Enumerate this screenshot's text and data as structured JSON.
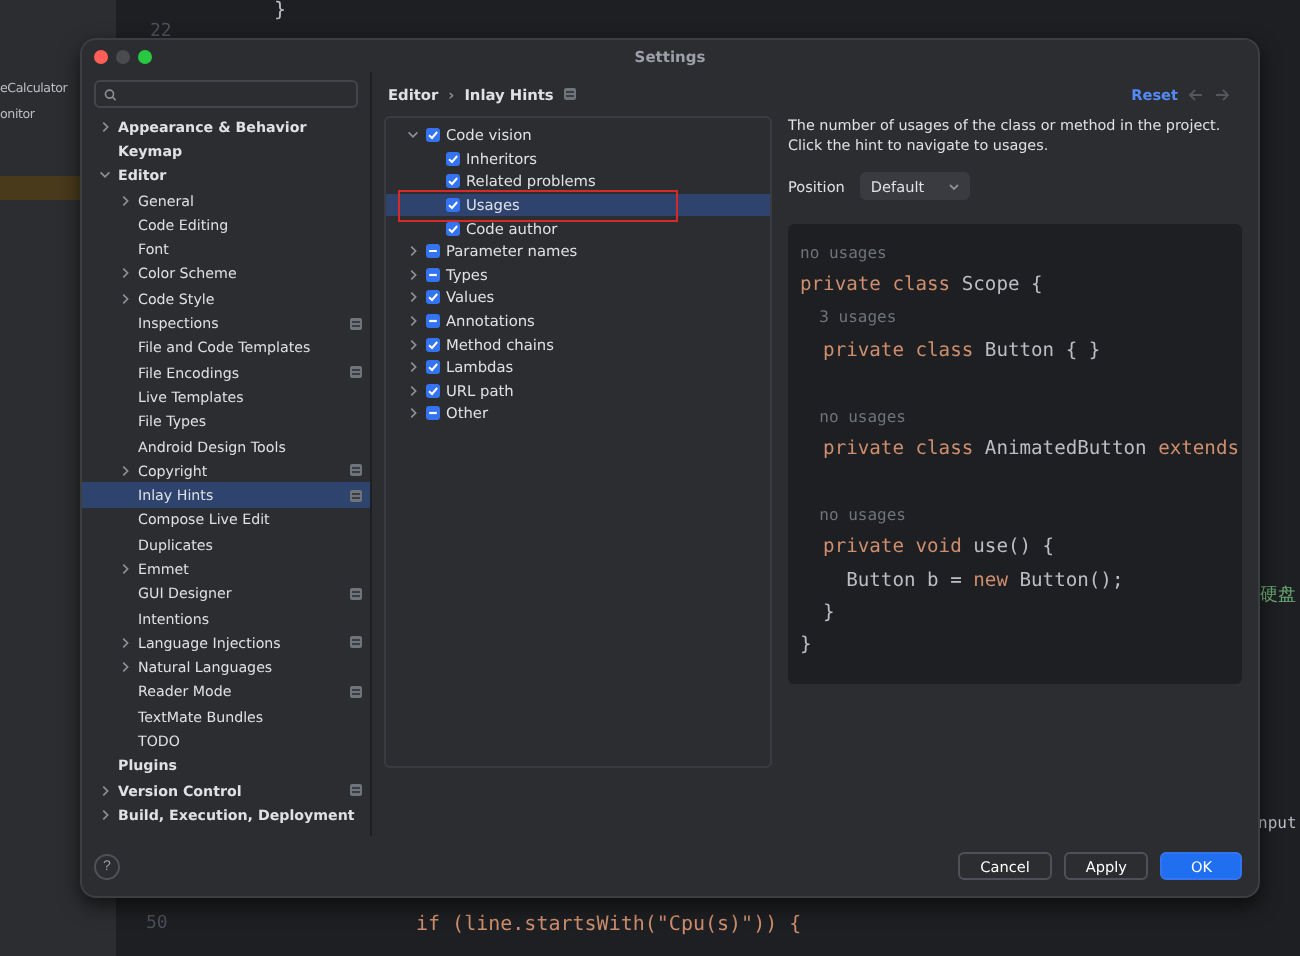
{
  "background": {
    "project_items": [
      "eCalculator",
      "onitor"
    ],
    "gutter": [
      "22",
      "50"
    ],
    "code": [
      "}",
      "if (line.startsWith(\"Cpu(s)\")) {"
    ],
    "side_texts": [
      "硬盘",
      "nput"
    ]
  },
  "window": {
    "title": "Settings"
  },
  "sidebar": {
    "items": [
      {
        "label": "Appearance & Behavior",
        "bold": true,
        "expanded": false,
        "has_children": true,
        "badge": false,
        "selected": false
      },
      {
        "label": "Keymap",
        "bold": true,
        "has_children": false,
        "badge": false,
        "selected": false
      },
      {
        "label": "Editor",
        "bold": true,
        "expanded": true,
        "has_children": true,
        "badge": false,
        "selected": false,
        "children": [
          {
            "label": "General",
            "has_children": true,
            "expanded": false,
            "badge": false,
            "selected": false
          },
          {
            "label": "Code Editing",
            "has_children": false,
            "badge": false,
            "selected": false
          },
          {
            "label": "Font",
            "has_children": false,
            "badge": false,
            "selected": false
          },
          {
            "label": "Color Scheme",
            "has_children": true,
            "expanded": false,
            "badge": false,
            "selected": false
          },
          {
            "label": "Code Style",
            "has_children": true,
            "expanded": false,
            "badge": false,
            "selected": false
          },
          {
            "label": "Inspections",
            "has_children": false,
            "badge": true,
            "selected": false
          },
          {
            "label": "File and Code Templates",
            "has_children": false,
            "badge": false,
            "selected": false
          },
          {
            "label": "File Encodings",
            "has_children": false,
            "badge": true,
            "selected": false
          },
          {
            "label": "Live Templates",
            "has_children": false,
            "badge": false,
            "selected": false
          },
          {
            "label": "File Types",
            "has_children": false,
            "badge": false,
            "selected": false
          },
          {
            "label": "Android Design Tools",
            "has_children": false,
            "badge": false,
            "selected": false
          },
          {
            "label": "Copyright",
            "has_children": true,
            "expanded": false,
            "badge": true,
            "selected": false
          },
          {
            "label": "Inlay Hints",
            "has_children": false,
            "badge": true,
            "selected": true
          },
          {
            "label": "Compose Live Edit",
            "has_children": false,
            "badge": false,
            "selected": false
          },
          {
            "label": "Duplicates",
            "has_children": false,
            "badge": false,
            "selected": false
          },
          {
            "label": "Emmet",
            "has_children": true,
            "expanded": false,
            "badge": false,
            "selected": false
          },
          {
            "label": "GUI Designer",
            "has_children": false,
            "badge": true,
            "selected": false
          },
          {
            "label": "Intentions",
            "has_children": false,
            "badge": false,
            "selected": false
          },
          {
            "label": "Language Injections",
            "has_children": true,
            "expanded": false,
            "badge": true,
            "selected": false
          },
          {
            "label": "Natural Languages",
            "has_children": true,
            "expanded": false,
            "badge": false,
            "selected": false
          },
          {
            "label": "Reader Mode",
            "has_children": false,
            "badge": true,
            "selected": false
          },
          {
            "label": "TextMate Bundles",
            "has_children": false,
            "badge": false,
            "selected": false
          },
          {
            "label": "TODO",
            "has_children": false,
            "badge": false,
            "selected": false
          }
        ]
      },
      {
        "label": "Plugins",
        "bold": true,
        "has_children": false,
        "badge": false,
        "selected": false
      },
      {
        "label": "Version Control",
        "bold": true,
        "expanded": false,
        "has_children": true,
        "badge": true,
        "selected": false
      },
      {
        "label": "Build, Execution, Deployment",
        "bold": true,
        "expanded": false,
        "has_children": true,
        "badge": false,
        "selected": false
      }
    ]
  },
  "breadcrumb": {
    "parent": "Editor",
    "separator": "›",
    "current": "Inlay Hints",
    "badge": true
  },
  "reset": "Reset",
  "hints_tree": [
    {
      "label": "Code vision",
      "checked": true,
      "partial": false,
      "expanded": true,
      "selected": false,
      "children": [
        {
          "label": "Inheritors",
          "checked": true,
          "partial": false,
          "selected": false,
          "highlighted": false
        },
        {
          "label": "Related problems",
          "checked": true,
          "partial": false,
          "selected": false,
          "highlighted": false
        },
        {
          "label": "Usages",
          "checked": true,
          "partial": false,
          "selected": true,
          "highlighted": true
        },
        {
          "label": "Code author",
          "checked": true,
          "partial": false,
          "selected": false,
          "highlighted": false
        }
      ]
    },
    {
      "label": "Parameter names",
      "checked": true,
      "partial": true,
      "expanded": false,
      "selected": false
    },
    {
      "label": "Types",
      "checked": true,
      "partial": true,
      "expanded": false,
      "selected": false
    },
    {
      "label": "Values",
      "checked": true,
      "partial": false,
      "expanded": false,
      "selected": false
    },
    {
      "label": "Annotations",
      "checked": true,
      "partial": true,
      "expanded": false,
      "selected": false
    },
    {
      "label": "Method chains",
      "checked": true,
      "partial": false,
      "expanded": false,
      "selected": false
    },
    {
      "label": "Lambdas",
      "checked": true,
      "partial": false,
      "expanded": false,
      "selected": false
    },
    {
      "label": "URL path",
      "checked": true,
      "partial": false,
      "expanded": false,
      "selected": false
    },
    {
      "label": "Other",
      "checked": true,
      "partial": true,
      "expanded": false,
      "selected": false
    }
  ],
  "description": "The number of usages of the class or method in the project. Click the hint to navigate to usages.",
  "position": {
    "label": "Position",
    "value": "Default"
  },
  "preview": [
    {
      "gap_before": false,
      "segments": [
        {
          "text": "no usages",
          "kind": "hint"
        }
      ]
    },
    {
      "gap_before": false,
      "segments": [
        {
          "text": "private class ",
          "kind": "keyword"
        },
        {
          "text": "Scope {",
          "kind": "plain"
        }
      ]
    },
    {
      "gap_before": false,
      "segments": [
        {
          "text": "  3 usages",
          "kind": "hint"
        }
      ]
    },
    {
      "gap_before": false,
      "segments": [
        {
          "text": "  private class ",
          "kind": "keyword"
        },
        {
          "text": "Button { }",
          "kind": "plain"
        }
      ]
    },
    {
      "gap_before": true,
      "segments": [
        {
          "text": "  no usages",
          "kind": "hint"
        }
      ]
    },
    {
      "gap_before": false,
      "segments": [
        {
          "text": "  private class ",
          "kind": "keyword"
        },
        {
          "text": "AnimatedButton ",
          "kind": "plain"
        },
        {
          "text": "extends",
          "kind": "keyword"
        }
      ]
    },
    {
      "gap_before": true,
      "segments": [
        {
          "text": "  no usages",
          "kind": "hint"
        }
      ]
    },
    {
      "gap_before": false,
      "segments": [
        {
          "text": "  private void ",
          "kind": "keyword"
        },
        {
          "text": "use() {",
          "kind": "plain"
        }
      ]
    },
    {
      "gap_before": false,
      "segments": [
        {
          "text": "    Button b = ",
          "kind": "plain"
        },
        {
          "text": "new ",
          "kind": "keyword"
        },
        {
          "text": "Button();",
          "kind": "plain"
        }
      ]
    },
    {
      "gap_before": false,
      "segments": [
        {
          "text": "  }",
          "kind": "plain"
        }
      ]
    },
    {
      "gap_before": false,
      "segments": [
        {
          "text": "}",
          "kind": "plain"
        }
      ]
    }
  ],
  "help": "?",
  "buttons": [
    {
      "label": "Cancel",
      "primary": false
    },
    {
      "label": "Apply",
      "primary": false
    },
    {
      "label": "OK",
      "primary": true
    }
  ]
}
